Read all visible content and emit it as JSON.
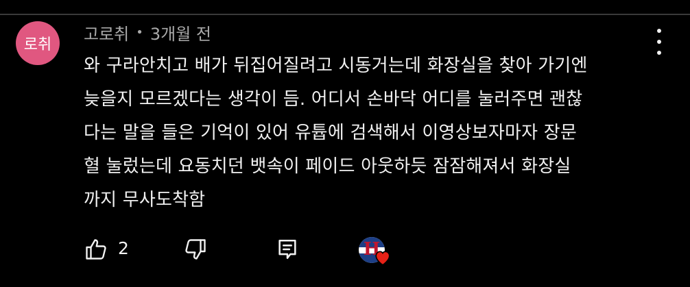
{
  "comment": {
    "avatar_text": "로취",
    "author": "고로취",
    "separator": "•",
    "time": "3개월 전",
    "body_lines": [
      "와 구라안치고 배가 뒤집어질려고 시동거는데 화장실을 찾아 가기엔",
      "늦을지 모르겠다는 생각이 듬. 어디서 손바닥 어디를 눌러주면 괜찮",
      "다는 말을 들은 기억이 있어 유튭에 검색해서 이영상보자마자 장문",
      "혈 눌렀는데 요동치던 뱃속이 페이드 아웃하듯 잠잠해져서 화장실",
      "까지 무사도착함"
    ]
  },
  "actions": {
    "like_icon": "thumbs-up-icon",
    "like_count": "2",
    "dislike_icon": "thumbs-down-icon",
    "reply_icon": "reply-comment-icon",
    "creator_heart": {
      "avatar_letter": "H",
      "icon": "heart-icon"
    }
  },
  "more_menu_icon": "more-vertical-icon",
  "colors": {
    "background": "#000000",
    "avatar_bg": "#e05780",
    "text_primary": "#f1f1f1",
    "text_secondary": "#aaaaaa",
    "heart": "#e62117",
    "creator_blue": "#1d3f86",
    "creator_red": "#c0172f"
  }
}
